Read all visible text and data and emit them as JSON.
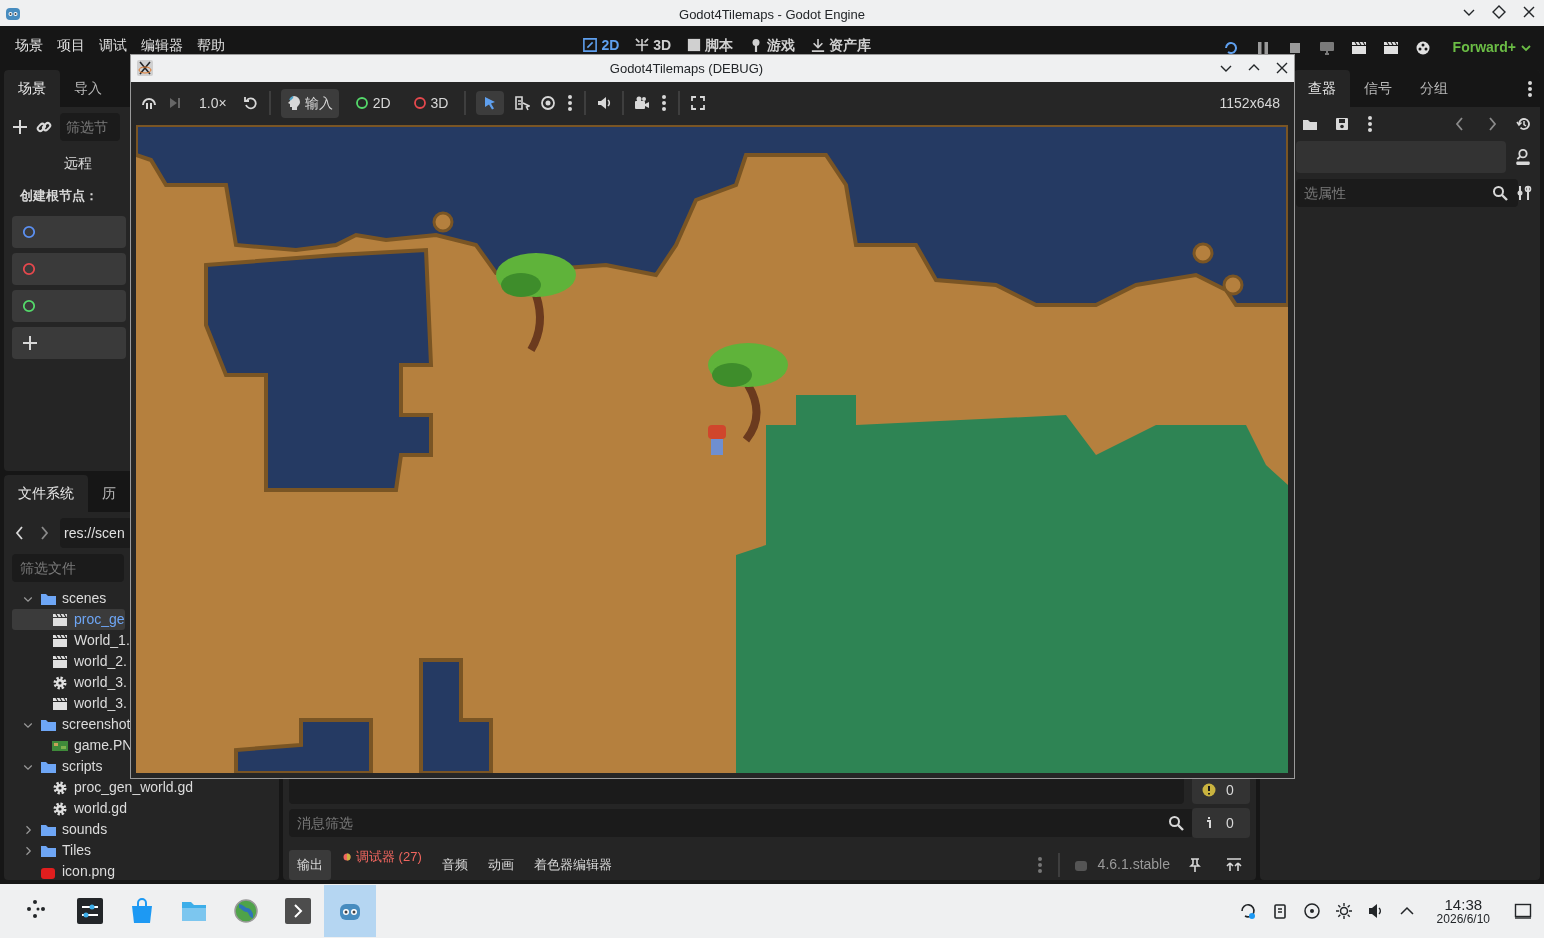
{
  "window": {
    "title": "Godot4Tilemaps - Godot Engine"
  },
  "menu": [
    "场景",
    "项目",
    "调试",
    "编辑器",
    "帮助"
  ],
  "workspaces": [
    {
      "label": "2D",
      "selected": true
    },
    {
      "label": "3D",
      "selected": false
    },
    {
      "label": "脚本",
      "selected": false
    },
    {
      "label": "游戏",
      "selected": false
    },
    {
      "label": "资产库",
      "selected": false
    }
  ],
  "renderer": "Forward+",
  "scene_dock": {
    "tabs": [
      {
        "label": "场景",
        "selected": true
      },
      {
        "label": "导入",
        "selected": false
      }
    ],
    "filter": {
      "placeholder": "筛选节"
    },
    "remote": "远程",
    "create_root_label": "创建根节点：",
    "root_buttons": [
      {
        "kind": "circle",
        "color": "#5b8ff0"
      },
      {
        "kind": "circle",
        "color": "#e5484d"
      },
      {
        "kind": "circle",
        "color": "#54d96a"
      },
      {
        "kind": "plus"
      }
    ]
  },
  "filesystem": {
    "tabs": [
      {
        "label": "文件系统",
        "selected": true
      },
      {
        "label": "历",
        "selected": false
      }
    ],
    "path": "res://scen",
    "filter": {
      "placeholder": "筛选文件"
    },
    "tree": [
      {
        "name": "scenes",
        "kind": "folder",
        "expanded": true,
        "selected": false,
        "children": [
          {
            "name": "proc_ge",
            "kind": "scene",
            "selected": true
          },
          {
            "name": "World_1.",
            "kind": "scene",
            "selected": false
          },
          {
            "name": "world_2.",
            "kind": "scene",
            "selected": false
          },
          {
            "name": "world_3.",
            "kind": "script",
            "selected": false
          },
          {
            "name": "world_3.",
            "kind": "scene",
            "selected": false
          }
        ]
      },
      {
        "name": "screenshot",
        "kind": "folder",
        "expanded": true,
        "selected": false,
        "children": [
          {
            "name": "game.PN",
            "kind": "image",
            "selected": false
          }
        ]
      },
      {
        "name": "scripts",
        "kind": "folder",
        "expanded": true,
        "selected": false,
        "children": [
          {
            "name": "proc_gen_world.gd",
            "kind": "script",
            "selected": false
          },
          {
            "name": "world.gd",
            "kind": "script",
            "selected": false
          }
        ]
      },
      {
        "name": "sounds",
        "kind": "folder",
        "expanded": false,
        "selected": false
      },
      {
        "name": "Tiles",
        "kind": "folder",
        "expanded": false,
        "selected": false
      },
      {
        "name": "icon.png",
        "kind": "logo",
        "selected": false
      }
    ]
  },
  "inspector": {
    "tabs": [
      {
        "label": "查器",
        "selected": true
      },
      {
        "label": "信号",
        "selected": false
      },
      {
        "label": "分组",
        "selected": false
      }
    ],
    "filter": {
      "placeholder": "选属性"
    }
  },
  "bottom_panel": {
    "warning_count": "0",
    "info_count": "0",
    "filter": {
      "placeholder": "消息筛选"
    },
    "tabs": [
      {
        "label": "输出",
        "selected": true,
        "alert": false
      },
      {
        "label": "调试器 (27)",
        "selected": false,
        "alert": true
      },
      {
        "label": "音频",
        "selected": false,
        "alert": false
      },
      {
        "label": "动画",
        "selected": false,
        "alert": false
      },
      {
        "label": "着色器编辑器",
        "selected": false,
        "alert": false
      }
    ],
    "version": "4.6.1.stable"
  },
  "debug_window": {
    "title": "Godot4Tilemaps (DEBUG)",
    "speed": "1.0×",
    "input": {
      "label": "输入",
      "selected": true
    },
    "modes": [
      {
        "label": "2D",
        "color": "#54d96a"
      },
      {
        "label": "3D",
        "color": "#e5484d"
      }
    ],
    "select_tool": {
      "selected": true
    },
    "resolution": "1152x648"
  },
  "taskbar": {
    "apps": [
      {
        "kind": "launcher",
        "selected": false
      },
      {
        "kind": "settings",
        "selected": false
      },
      {
        "kind": "store",
        "selected": false
      },
      {
        "kind": "files",
        "selected": false
      },
      {
        "kind": "globe",
        "selected": false
      },
      {
        "kind": "terminal",
        "selected": false
      },
      {
        "kind": "godot",
        "selected": true
      }
    ],
    "time": "14:38",
    "date": "2026/6/10"
  }
}
